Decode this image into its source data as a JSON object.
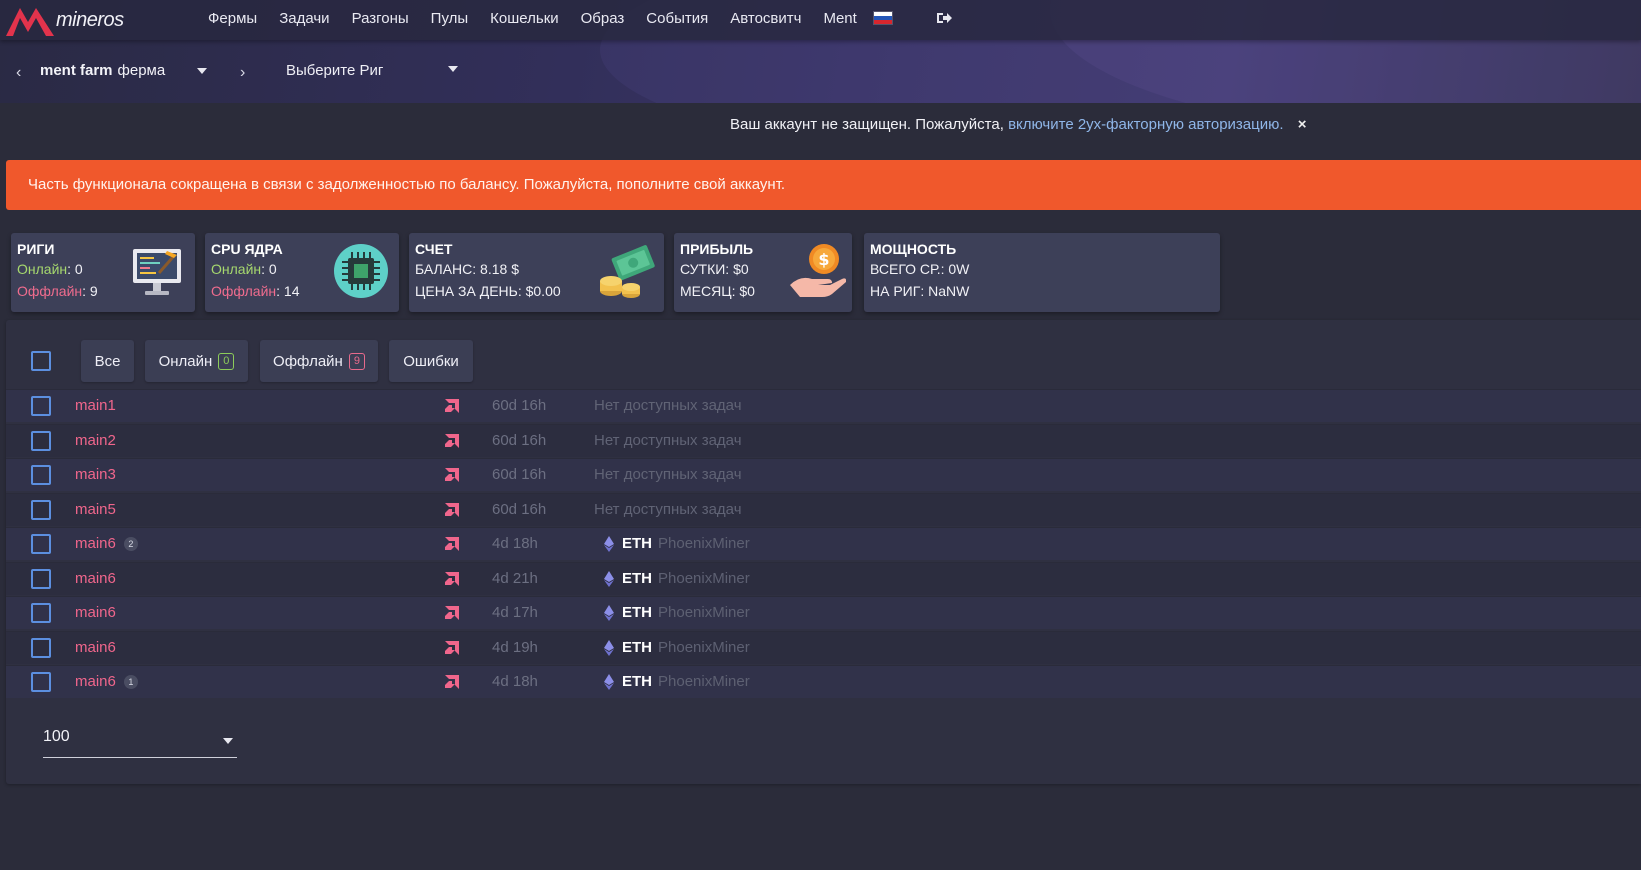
{
  "app": {
    "logo_text": "mineros",
    "nav": [
      "Фермы",
      "Задачи",
      "Разгоны",
      "Пулы",
      "Кошельки",
      "Образ",
      "События",
      "Автосвитч",
      "Ment"
    ]
  },
  "farmbar": {
    "farm_name": "ment farm",
    "farm_suffix": "ферма",
    "rig_placeholder": "Выберите Риг"
  },
  "notice": {
    "text": "Ваш аккаунт не защищен. Пожалуйста,",
    "link": "включите 2ух-факторную авторизацию.",
    "close": "×"
  },
  "alert": {
    "text": "Часть функционала сокращена в связи с задолженностью по балансу. Пожалуйста, пополните свой аккаунт."
  },
  "cards": {
    "rigs": {
      "title": "РИГИ",
      "online_label": "Онлайн",
      "online_value": ": 0",
      "offline_label": "Оффлайн",
      "offline_value": ": 9"
    },
    "cpu": {
      "title": "CPU ЯДРА",
      "online_label": "Онлайн",
      "online_value": ": 0",
      "offline_label": "Оффлайн",
      "offline_value": ": 14"
    },
    "account": {
      "title": "СЧЕТ",
      "balance": "БАЛАНС: 8.18 $",
      "daily_price": "ЦЕНА ЗА ДЕНЬ: $0.00"
    },
    "profit": {
      "title": "ПРИБЫЛЬ",
      "day": "СУТКИ: $0",
      "month": "МЕСЯЦ: $0"
    },
    "power": {
      "title": "МОЩНОСТЬ",
      "total": "ВСЕГО СР.: 0W",
      "per_rig": "НА РИГ: NaNW"
    }
  },
  "filters": {
    "all": "Все",
    "online": "Онлайн",
    "online_count": "0",
    "offline": "Оффлайн",
    "offline_count": "9",
    "errors": "Ошибки"
  },
  "rigs": [
    {
      "name": "main1",
      "gpu_badge": "",
      "uptime": "60d 16h",
      "task": "Нет доступных задач",
      "coin": "",
      "miner": ""
    },
    {
      "name": "main2",
      "gpu_badge": "",
      "uptime": "60d 16h",
      "task": "Нет доступных задач",
      "coin": "",
      "miner": ""
    },
    {
      "name": "main3",
      "gpu_badge": "",
      "uptime": "60d 16h",
      "task": "Нет доступных задач",
      "coin": "",
      "miner": ""
    },
    {
      "name": "main5",
      "gpu_badge": "",
      "uptime": "60d 16h",
      "task": "Нет доступных задач",
      "coin": "",
      "miner": ""
    },
    {
      "name": "main6",
      "gpu_badge": "2",
      "uptime": "4d 18h",
      "task": "",
      "coin": "ETH",
      "miner": "PhoenixMiner"
    },
    {
      "name": "main6",
      "gpu_badge": "",
      "uptime": "4d 21h",
      "task": "",
      "coin": "ETH",
      "miner": "PhoenixMiner"
    },
    {
      "name": "main6",
      "gpu_badge": "",
      "uptime": "4d 17h",
      "task": "",
      "coin": "ETH",
      "miner": "PhoenixMiner"
    },
    {
      "name": "main6",
      "gpu_badge": "",
      "uptime": "4d 19h",
      "task": "",
      "coin": "ETH",
      "miner": "PhoenixMiner"
    },
    {
      "name": "main6",
      "gpu_badge": "1",
      "uptime": "4d 18h",
      "task": "",
      "coin": "ETH",
      "miner": "PhoenixMiner"
    }
  ],
  "pagination": {
    "page_size": "100"
  },
  "colors": {
    "accent_orange": "#f0582c",
    "rig_name_pink": "#f0668c",
    "online_green": "#a6d86e",
    "checkbox_blue": "#5c8fe0"
  },
  "icons": {
    "logo": "mineros-logo-icon",
    "flag": "russian-flag-icon",
    "logout": "logout-icon",
    "rigs_card": "computer-tools-icon",
    "cpu_card": "cpu-chip-icon",
    "account_card": "money-coins-icon",
    "profit_card": "hand-coin-icon",
    "amd": "amd-logo-icon",
    "eth": "ethereum-icon"
  }
}
